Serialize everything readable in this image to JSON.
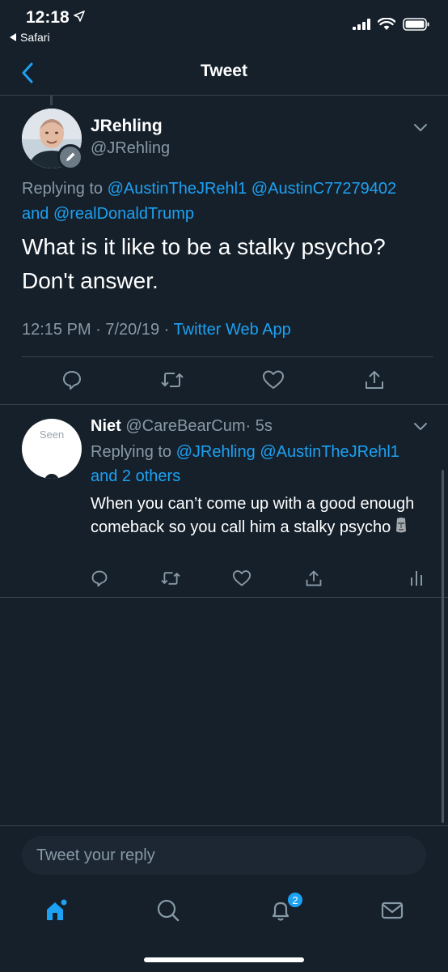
{
  "status_bar": {
    "time": "12:18",
    "back_app": "Safari"
  },
  "header": {
    "title": "Tweet"
  },
  "main_tweet": {
    "name": "JRehling",
    "handle": "@JRehling",
    "replying_prefix": "Replying to",
    "mention_1": "@AustinTheJRehl1",
    "mention_2": "@AustinC77279402",
    "and_word": "and",
    "mention_3": "@realDonaldTrump",
    "text": "What is it like to be a stalky psycho? Don't answer.",
    "time": "12:15 PM · 7/20/19 · ",
    "source": "Twitter Web App"
  },
  "reply_tweet": {
    "avatar_text": "Seen",
    "name": "Niet",
    "handle": "@CareBearCum",
    "age": "· 5s",
    "replying_prefix": "Replying to",
    "mention_1": "@JRehling",
    "mention_2": "@AustinTheJRehl1",
    "others": "and 2 others",
    "text": "When you can’t come up with a good enough comeback so you call him a stalky psycho"
  },
  "composer": {
    "placeholder": "Tweet your reply"
  },
  "tabbar": {
    "notifications_count": "2"
  },
  "colors": {
    "background": "#15202b",
    "accent": "#1da1f2",
    "muted": "#8899a6",
    "divider": "#38444d"
  }
}
